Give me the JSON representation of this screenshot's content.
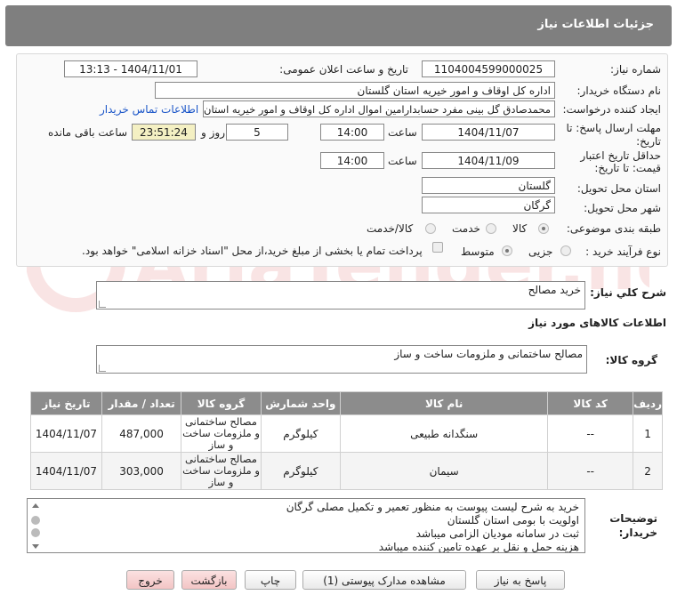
{
  "header": {
    "title": "جزئیات اطلاعات نیاز"
  },
  "form": {
    "need_number_label": "شماره نیاز:",
    "need_number": "1104004599000025",
    "announce_label": "تاریخ و ساعت اعلان عمومی:",
    "announce_value": "1404/11/01 - 13:13",
    "buyer_org_label": "نام دستگاه خریدار:",
    "buyer_org": "اداره کل اوقاف و امور خیریه استان گلستان",
    "requester_label": "ایجاد کننده درخواست:",
    "requester": "محمدصادق گل بینی مفرد حسابدارامین اموال اداره کل اوقاف و امور خیریه استان",
    "contact_link": "اطلاعات تماس خریدار",
    "reply_deadline_label_1": "مهلت ارسال پاسخ: تا",
    "reply_deadline_label_2": "تاریخ:",
    "reply_date": "1404/11/07",
    "time_label": "ساعت",
    "reply_time": "14:00",
    "days_value": "5",
    "days_label": "روز و",
    "remaining_time": "23:51:24",
    "remaining_label": "ساعت باقی مانده",
    "validity_label_1": "حداقل تاریخ اعتبار",
    "validity_label_2": "قیمت: تا تاریخ:",
    "validity_date": "1404/11/09",
    "validity_time": "14:00",
    "province_label": "استان محل تحویل:",
    "province": "گلستان",
    "city_label": "شهر محل تحویل:",
    "city": "گرگان",
    "category_label": "طبقه بندی موضوعی:",
    "category_options": [
      "کالا",
      "خدمت",
      "کالا/خدمت"
    ],
    "process_label": "نوع فرآیند خرید :",
    "process_options": [
      "جزیی",
      "متوسط"
    ],
    "payment_note": "پرداخت تمام یا بخشی از مبلغ خرید،از محل \"اسناد خزانه اسلامی\" خواهد بود."
  },
  "summary": {
    "label": "شرح کلي نياز:",
    "value": "خريد مصالح"
  },
  "goods": {
    "section_title": "اطلاعات کالاهای مورد نیاز",
    "group_label": "گروه کالا:",
    "group_value": "مصالح ساختمانی و ملزومات ساخت و ساز",
    "columns": [
      "ردیف",
      "کد کالا",
      "نام کالا",
      "واحد شمارش",
      "گروه کالا",
      "تعداد / مقدار",
      "تاریخ نیاز"
    ],
    "rows": [
      {
        "row": "1",
        "code": "--",
        "name": "سنگدانه طبیعی",
        "unit": "کیلوگرم",
        "group_1": "مصالح ساختمانی",
        "group_2": "و ملزومات ساخت",
        "group_3": "و ساز",
        "qty": "487,000",
        "date": "1404/11/07"
      },
      {
        "row": "2",
        "code": "--",
        "name": "سیمان",
        "unit": "کیلوگرم",
        "group_1": "مصالح ساختمانی",
        "group_2": "و ملزومات ساخت",
        "group_3": "و ساز",
        "qty": "303,000",
        "date": "1404/11/07"
      }
    ]
  },
  "notes": {
    "label_1": "توضیحات",
    "label_2": "خریدار:",
    "lines": [
      "خرید به شرح لیست پیوست به منظور تعمیر و تکمیل مصلی گرگان",
      "اولویت با بومی استان گلستان",
      "ثبت در سامانه مودیان الزامی میباشد",
      "هزینه حمل و نقل بر عهده تامین کننده میباشد"
    ]
  },
  "buttons": {
    "reply": "پاسخ به نیاز",
    "docs": "مشاهده مدارک پیوستی (1)",
    "print": "چاپ",
    "back": "بازگشت",
    "exit": "خروج"
  },
  "watermark": {
    "text": "AriaTender.net"
  }
}
